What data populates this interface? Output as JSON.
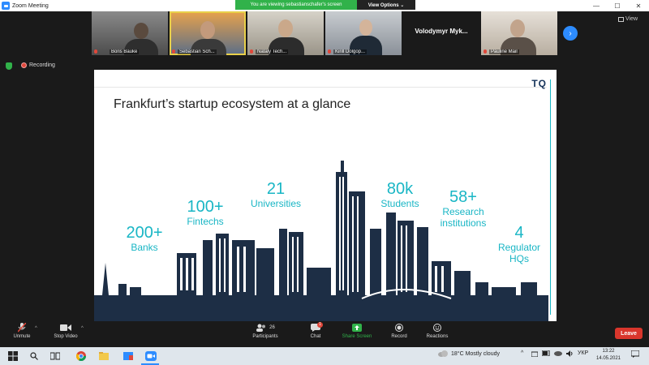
{
  "window": {
    "title": "Zoom Meeting",
    "min": "—",
    "max": "☐",
    "close": "✕"
  },
  "banner": {
    "viewing": "You are viewing sebastianschafer's screen",
    "options": "View Options ⌄"
  },
  "participants": [
    {
      "name": "Boris Bauke"
    },
    {
      "name": "Sebastian Sch..."
    },
    {
      "name": "Nataly Tech..."
    },
    {
      "name": "Kirill Dolgop..."
    },
    {
      "name": "Volodymyr  Myk..."
    },
    {
      "name": "Pauline Mail"
    }
  ],
  "gallery": {
    "view_label": "View"
  },
  "recording": {
    "label": "Recording"
  },
  "slide": {
    "logo": "TQ",
    "title": "Frankfurt’s startup ecosystem at a glance",
    "stats": [
      {
        "num": "200+",
        "label": "Banks"
      },
      {
        "num": "100+",
        "label": "Fintechs"
      },
      {
        "num": "21",
        "label": "Universities"
      },
      {
        "num": "80k",
        "label": "Students"
      },
      {
        "num": "58+",
        "label": "Research institutions"
      },
      {
        "num": "4",
        "label": "Regulator HQs"
      }
    ]
  },
  "toolbar": {
    "unmute": "Unmute",
    "stop_video": "Stop Video",
    "participants": "Participants",
    "participant_count": "26",
    "chat": "Chat",
    "chat_badge": "1",
    "share": "Share Screen",
    "record": "Record",
    "reactions": "Reactions",
    "leave": "Leave"
  },
  "taskbar": {
    "weather": "18°C  Mostly cloudy",
    "lang": "УКР",
    "time": "13:22",
    "date": "14.05.2021"
  },
  "colors": {
    "accent": "#19b6c5",
    "zoom_blue": "#2d8cff",
    "leave_red": "#d9362c",
    "share_green": "#31b24a"
  },
  "icons": [
    "zoom-icon",
    "shield-icon",
    "record-dot-icon",
    "mic-muted-icon",
    "video-icon",
    "participants-icon",
    "chat-icon",
    "share-icon",
    "record-icon",
    "reactions-icon",
    "windows-icon",
    "search-icon",
    "chrome-icon",
    "folder-icon"
  ]
}
